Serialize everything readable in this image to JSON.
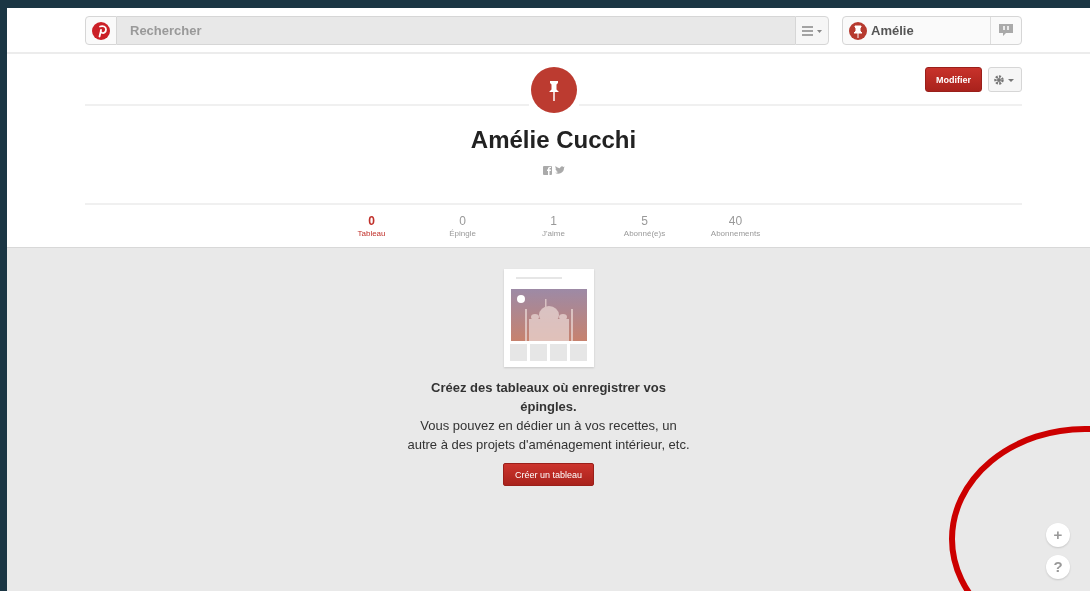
{
  "header": {
    "search": {
      "placeholder": "Rechercher"
    },
    "user": {
      "name": "Amélie"
    }
  },
  "profile": {
    "edit_button": "Modifier",
    "name": "Amélie Cucchi"
  },
  "stats": [
    {
      "count": "0",
      "label": "Tableau",
      "selected": true
    },
    {
      "count": "0",
      "label": "Épingle",
      "selected": false
    },
    {
      "count": "1",
      "label": "J'aime",
      "selected": false
    },
    {
      "count": "5",
      "label": "Abonné(e)s",
      "selected": false
    },
    {
      "count": "40",
      "label": "Abonnements",
      "selected": false
    }
  ],
  "empty_state": {
    "title": "Créez des tableaux où enregistrer vos épingles.",
    "text": "Vous pouvez en dédier un à vos recettes, un autre à des projets d'aménagement intérieur, etc.",
    "button": "Créer un tableau"
  },
  "floating_buttons": [
    "+",
    "?"
  ]
}
